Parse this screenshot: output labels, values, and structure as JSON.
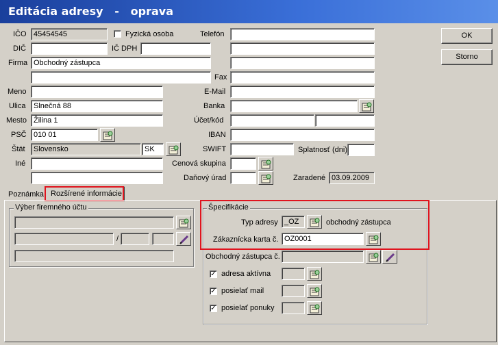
{
  "window": {
    "title": "Editácia adresy   -   oprava"
  },
  "buttons": {
    "ok": "OK",
    "storno": "Storno"
  },
  "fields": {
    "ico": {
      "label": "IČO",
      "value": "45454545"
    },
    "dic": {
      "label": "DIČ",
      "value": ""
    },
    "fyzicka": {
      "label": "Fyzická osoba",
      "checked": false
    },
    "icdph": {
      "label": "IČ DPH",
      "value": ""
    },
    "firma": {
      "label": "Firma",
      "value": "Obchodný zástupca",
      "value2": ""
    },
    "meno": {
      "label": "Meno",
      "value": ""
    },
    "ulica": {
      "label": "Ulica",
      "value": "Slnečná 88"
    },
    "mesto": {
      "label": "Mesto",
      "value": "Žilina 1"
    },
    "psc": {
      "label": "PSČ",
      "value": "010 01"
    },
    "stat": {
      "label": "Štát",
      "value": "Slovensko",
      "code": "SK"
    },
    "ine": {
      "label": "Iné",
      "value": "",
      "value2": ""
    },
    "telefon": {
      "label": "Telefón",
      "value": ""
    },
    "fax": {
      "label": "Fax",
      "value": ""
    },
    "email": {
      "label": "E-Mail",
      "value": ""
    },
    "banka": {
      "label": "Banka",
      "value": ""
    },
    "ucet": {
      "label": "Účet/kód",
      "value": "",
      "kod": ""
    },
    "iban": {
      "label": "IBAN",
      "value": ""
    },
    "swift": {
      "label": "SWIFT",
      "value": ""
    },
    "splatnost": {
      "label": "Splatnosť (dni)",
      "value": ""
    },
    "cenova": {
      "label": "Cenová skupina",
      "value": ""
    },
    "danovy": {
      "label": "Daňový úrad",
      "value": ""
    },
    "zaradene": {
      "label": "Zaradené",
      "value": "03.09.2009"
    }
  },
  "tabs": [
    {
      "label": "Poznámka"
    },
    {
      "label": "Rozšírené informácie"
    }
  ],
  "firemny": {
    "title": "Výber firemného účtu",
    "separator": "/"
  },
  "specifikacie": {
    "title": "Špecifikácie",
    "typ_label": "Typ adresy",
    "typ_value": "_OZ",
    "typ_desc": "obchodný zástupca",
    "karta_label": "Zákaznícka karta č.",
    "karta_value": "OZ0001"
  },
  "oz": {
    "label": "Obchodný zástupca č.",
    "value": ""
  },
  "checks": [
    {
      "label": "adresa aktívna",
      "checked": true
    },
    {
      "label": "posielať mail",
      "checked": true
    },
    {
      "label": "posielať ponuky",
      "checked": true
    }
  ],
  "colors": {
    "highlight": "#e0141e",
    "titlebar": "#1a3f9c"
  }
}
